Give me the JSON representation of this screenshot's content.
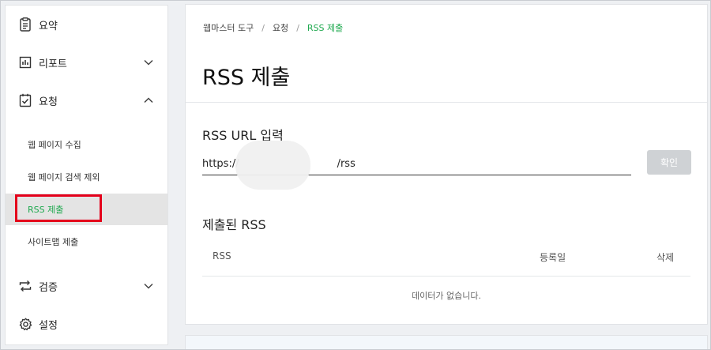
{
  "sidebar": {
    "items": [
      {
        "label": "요약",
        "icon": "summary-doc-icon"
      },
      {
        "label": "리포트",
        "icon": "report-chart-icon",
        "expanded": false
      },
      {
        "label": "요청",
        "icon": "request-clipboard-icon",
        "expanded": true,
        "sub_items": [
          {
            "label": "웹 페이지 수집"
          },
          {
            "label": "웹 페이지 검색 제외"
          },
          {
            "label": "RSS 제출",
            "active": true
          },
          {
            "label": "사이트맵 제출"
          }
        ]
      },
      {
        "label": "검증",
        "icon": "verify-arrows-icon",
        "expanded": false
      },
      {
        "label": "설정",
        "icon": "settings-gear-icon"
      }
    ]
  },
  "breadcrumb": {
    "items": [
      "웹마스터 도구",
      "요청",
      "RSS 제출"
    ],
    "separator": "/"
  },
  "page_title": "RSS 제출",
  "rss_form": {
    "label": "RSS URL 입력",
    "value": "https://                              /rss",
    "confirm_label": "확인"
  },
  "submitted": {
    "title": "제출된 RSS",
    "columns": [
      "RSS",
      "등록일",
      "삭제"
    ],
    "empty_text": "데이터가 없습니다."
  },
  "colors": {
    "accent_green": "#1fa94f",
    "highlight_red": "#e4001b",
    "disabled_button": "#cfd2d5"
  }
}
